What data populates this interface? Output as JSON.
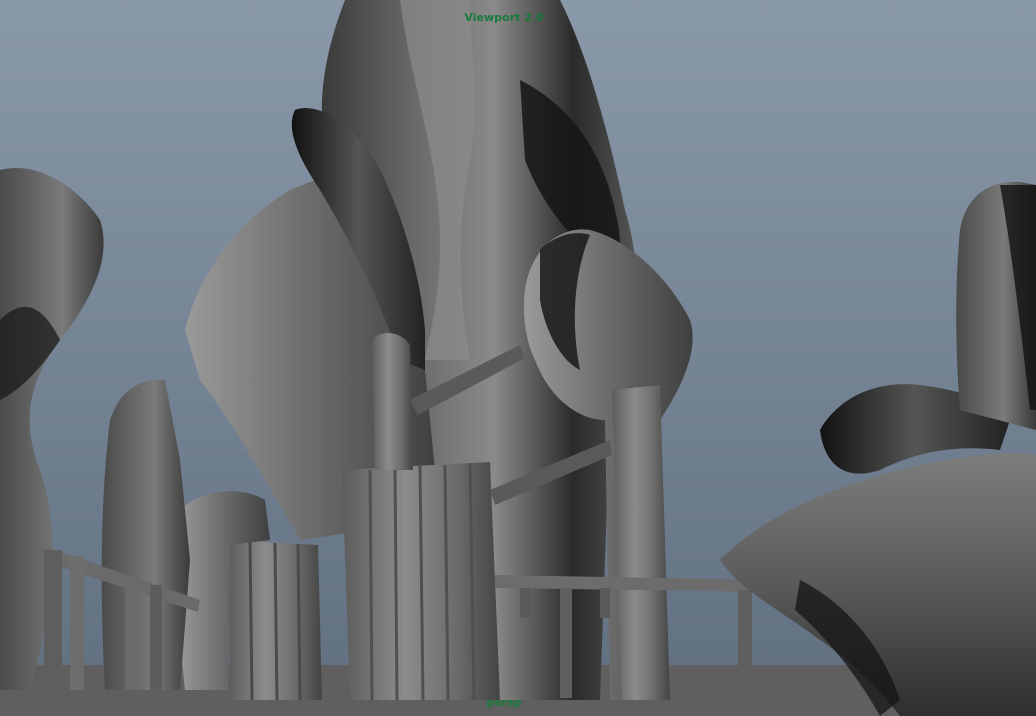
{
  "viewport": {
    "renderer_label": "Viewport 2.0",
    "camera_label": "persp",
    "hud_color": "#1a7a3a",
    "background_top": "#8a99aa",
    "background_bottom": "#606f80"
  },
  "scene": {
    "description_icon": "3d-model-icon",
    "shading": "default-grey"
  }
}
